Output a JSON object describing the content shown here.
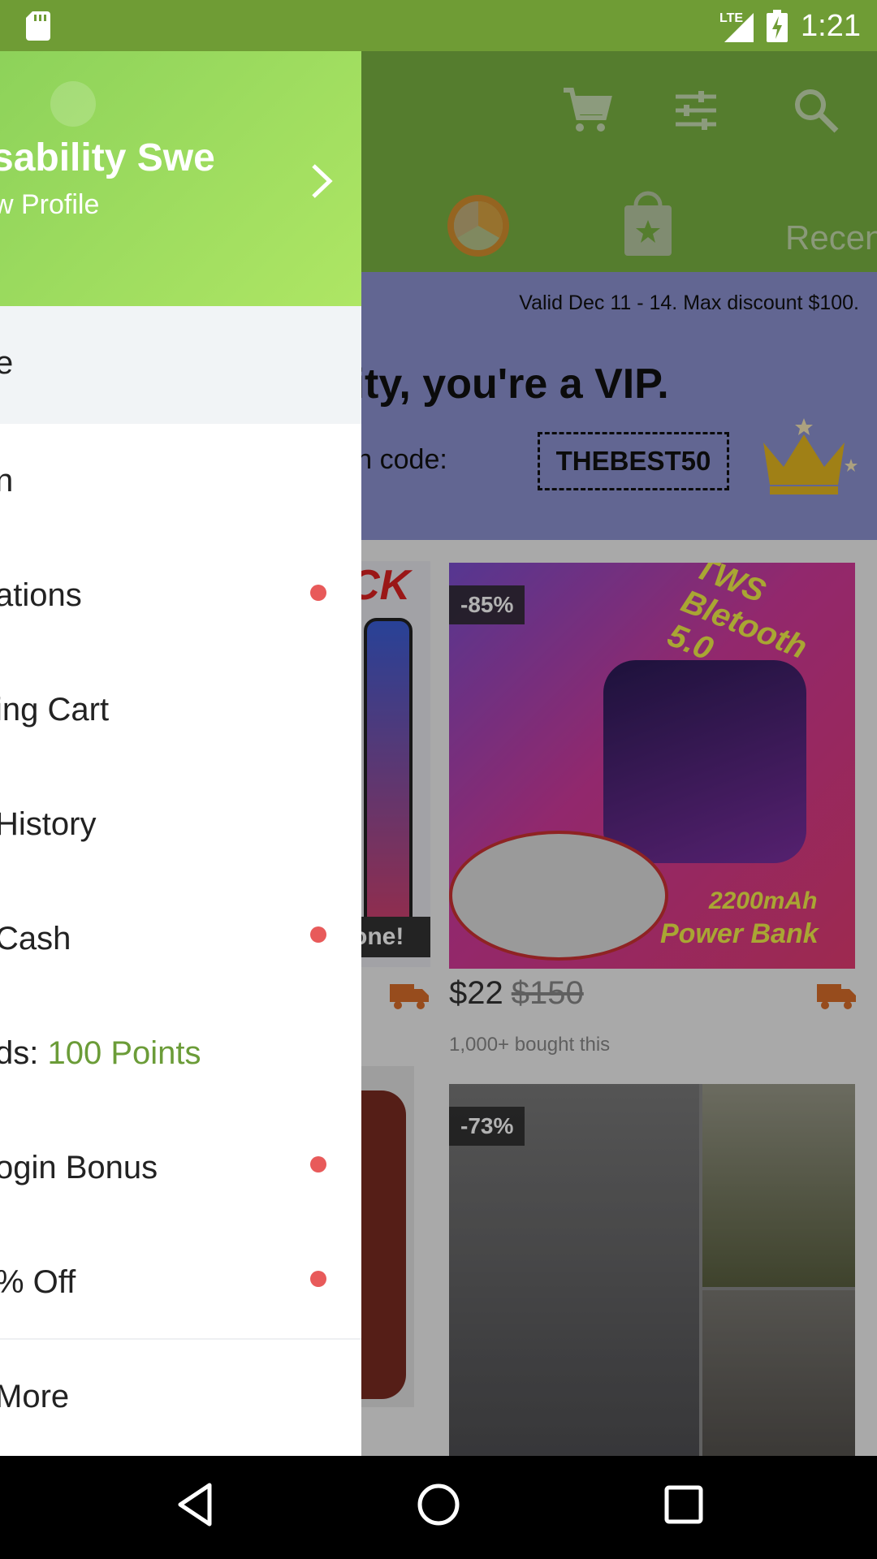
{
  "status_bar": {
    "network": "LTE",
    "time": "1:21"
  },
  "app": {
    "recent_tab_label": "Recen",
    "banner": {
      "valid_text": "Valid Dec 11 - 14. Max discount $100.",
      "headline": "ability, you're a VIP.",
      "code_prefix": "ff with code:",
      "code": "THEBEST50"
    },
    "products": [
      {
        "discount": "-85%",
        "price": "$22",
        "old_price": "$150",
        "bought": "1,000+ bought this"
      },
      {
        "discount": "-73%"
      }
    ],
    "partial_left_product": {
      "ribbon": "CK",
      "gone_label": "one!"
    }
  },
  "drawer": {
    "header": {
      "name": "sability Swe",
      "view_profile": "w Profile"
    },
    "items": [
      {
        "label": "e",
        "active": true,
        "dot": false
      },
      {
        "label": "n",
        "active": false,
        "dot": false
      },
      {
        "label": "ations",
        "active": false,
        "dot": true
      },
      {
        "label": "ing Cart",
        "active": false,
        "dot": false
      },
      {
        "label": "History",
        "active": false,
        "dot": false
      },
      {
        "label": "Cash",
        "active": false,
        "dot": true
      },
      {
        "label_prefix": "ds: ",
        "label_accent": "100 Points",
        "active": false,
        "dot": false
      },
      {
        "label": "ogin Bonus",
        "active": false,
        "dot": true
      },
      {
        "label": "% Off",
        "active": false,
        "dot": true
      },
      {
        "label": "More",
        "active": false,
        "dot": false
      }
    ]
  },
  "colors": {
    "status_bar": "#6f9c35",
    "app_bar": "#7ab342",
    "accent_green": "#6b9c38",
    "notification_dot": "#e85a5a",
    "banner": "#8d93d2"
  },
  "icons": {
    "status_sd": "sd-card-icon",
    "status_signal": "signal-icon",
    "status_battery": "battery-charging-icon",
    "cart": "cart-icon",
    "filter": "filter-icon",
    "search": "search-icon",
    "wheel": "wheel-icon",
    "star_bag": "star-bag-icon",
    "chevron": "chevron-right-icon",
    "truck": "truck-icon"
  }
}
